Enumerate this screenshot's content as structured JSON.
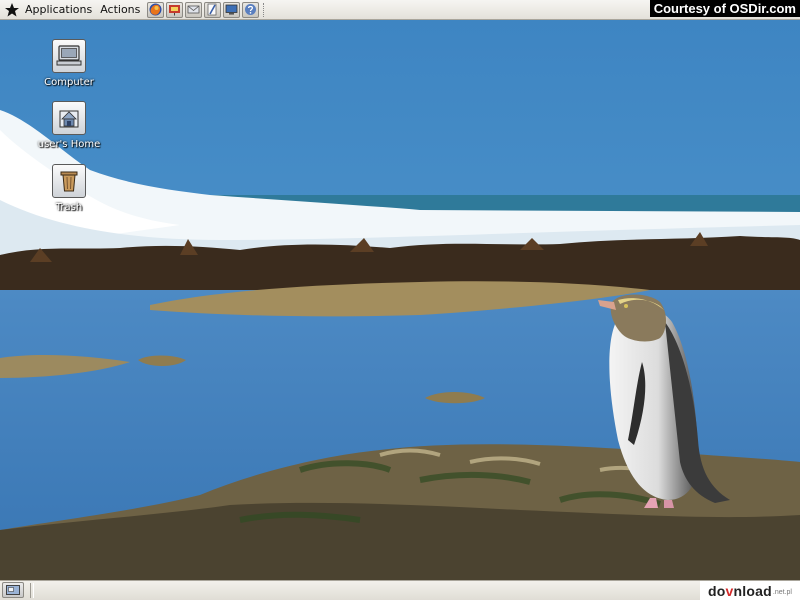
{
  "panel": {
    "menus": [
      {
        "label": "Applications"
      },
      {
        "label": "Actions"
      }
    ],
    "launchers": [
      {
        "icon": "firefox-icon"
      },
      {
        "icon": "presentation-icon"
      },
      {
        "icon": "mail-icon"
      },
      {
        "icon": "text-editor-icon"
      },
      {
        "icon": "monitor-icon"
      },
      {
        "icon": "help-icon"
      }
    ]
  },
  "desktop": {
    "icons": [
      {
        "label": "Computer",
        "icon": "computer-icon"
      },
      {
        "label": "user's Home",
        "icon": "home-folder-icon"
      },
      {
        "label": "Trash",
        "icon": "trash-icon"
      }
    ]
  },
  "watermarks": {
    "top": "Courtesy of OSDir.com",
    "bottom_main_pre": "do",
    "bottom_main_accent": "v",
    "bottom_main_post": "nload",
    "bottom_suffix": ".net.pl"
  },
  "colors": {
    "sky": "#3f86c3",
    "sea": "#4f86c0",
    "panel": "#ebe9e4"
  }
}
